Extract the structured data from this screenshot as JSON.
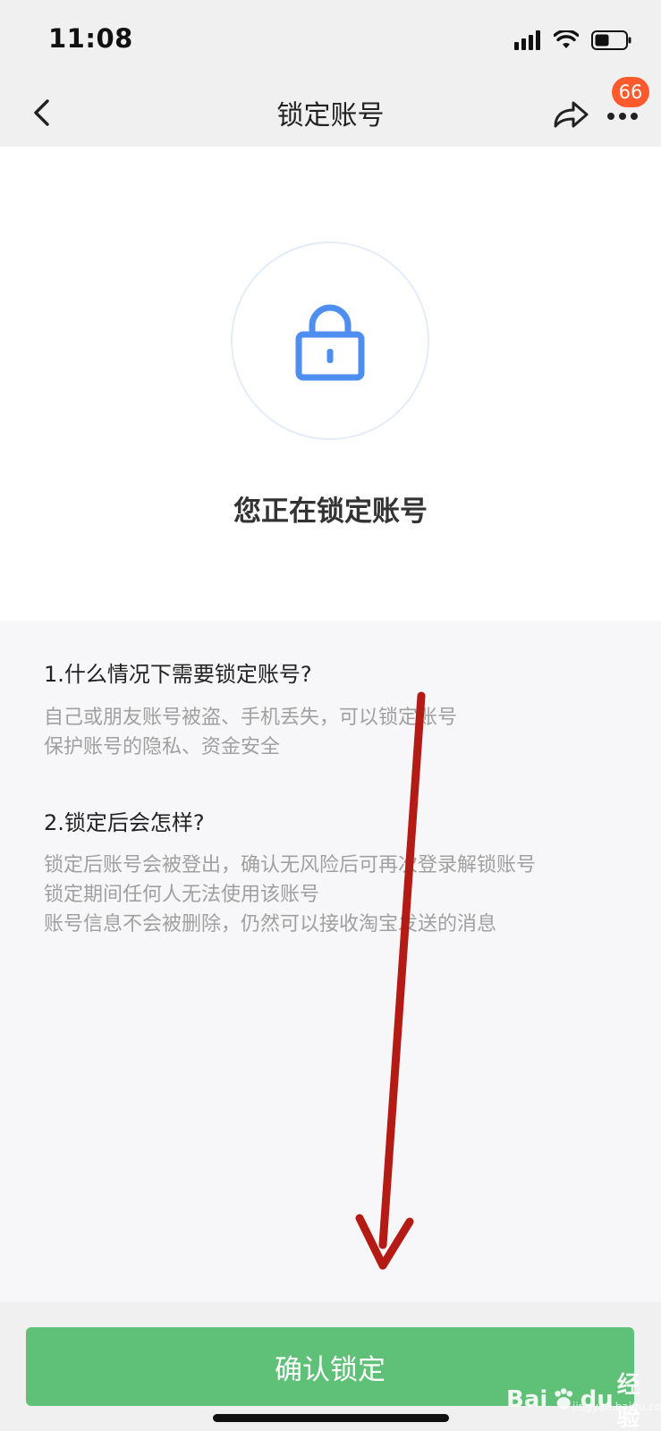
{
  "status_bar": {
    "time": "11:08",
    "signal_icon": "cellular-signal-icon",
    "wifi_icon": "wifi-icon",
    "battery_icon": "battery-icon"
  },
  "nav": {
    "title": "锁定账号",
    "back_icon": "chevron-left-icon",
    "share_icon": "share-icon",
    "more_icon": "more-dots-icon",
    "badge_count": "66"
  },
  "hero": {
    "lock_icon": "lock-icon",
    "title": "您正在锁定账号"
  },
  "info": {
    "sections": [
      {
        "heading": "1.什么情况下需要锁定账号?",
        "lines": [
          "自己或朋友账号被盗、手机丢失，可以锁定账号",
          "保护账号的隐私、资金安全"
        ]
      },
      {
        "heading": "2.锁定后会怎样?",
        "lines": [
          "锁定后账号会被登出，确认无风险后可再次登录解锁账号",
          "锁定期间任何人无法使用该账号",
          "账号信息不会被删除，仍然可以接收淘宝发送的消息"
        ]
      }
    ]
  },
  "footer": {
    "confirm_label": "确认锁定"
  },
  "annotation": {
    "arrow_icon": "red-arrow-annotation",
    "arrow_color": "#b31b14"
  },
  "watermark": {
    "brand": "Bai",
    "brand_suffix": "du",
    "brand_cn": "经验",
    "site": "jingyan.baidu.com"
  },
  "colors": {
    "accent_green": "#5fc178",
    "lock_blue": "#4d8ef0",
    "badge_orange": "#ff5a2d"
  }
}
